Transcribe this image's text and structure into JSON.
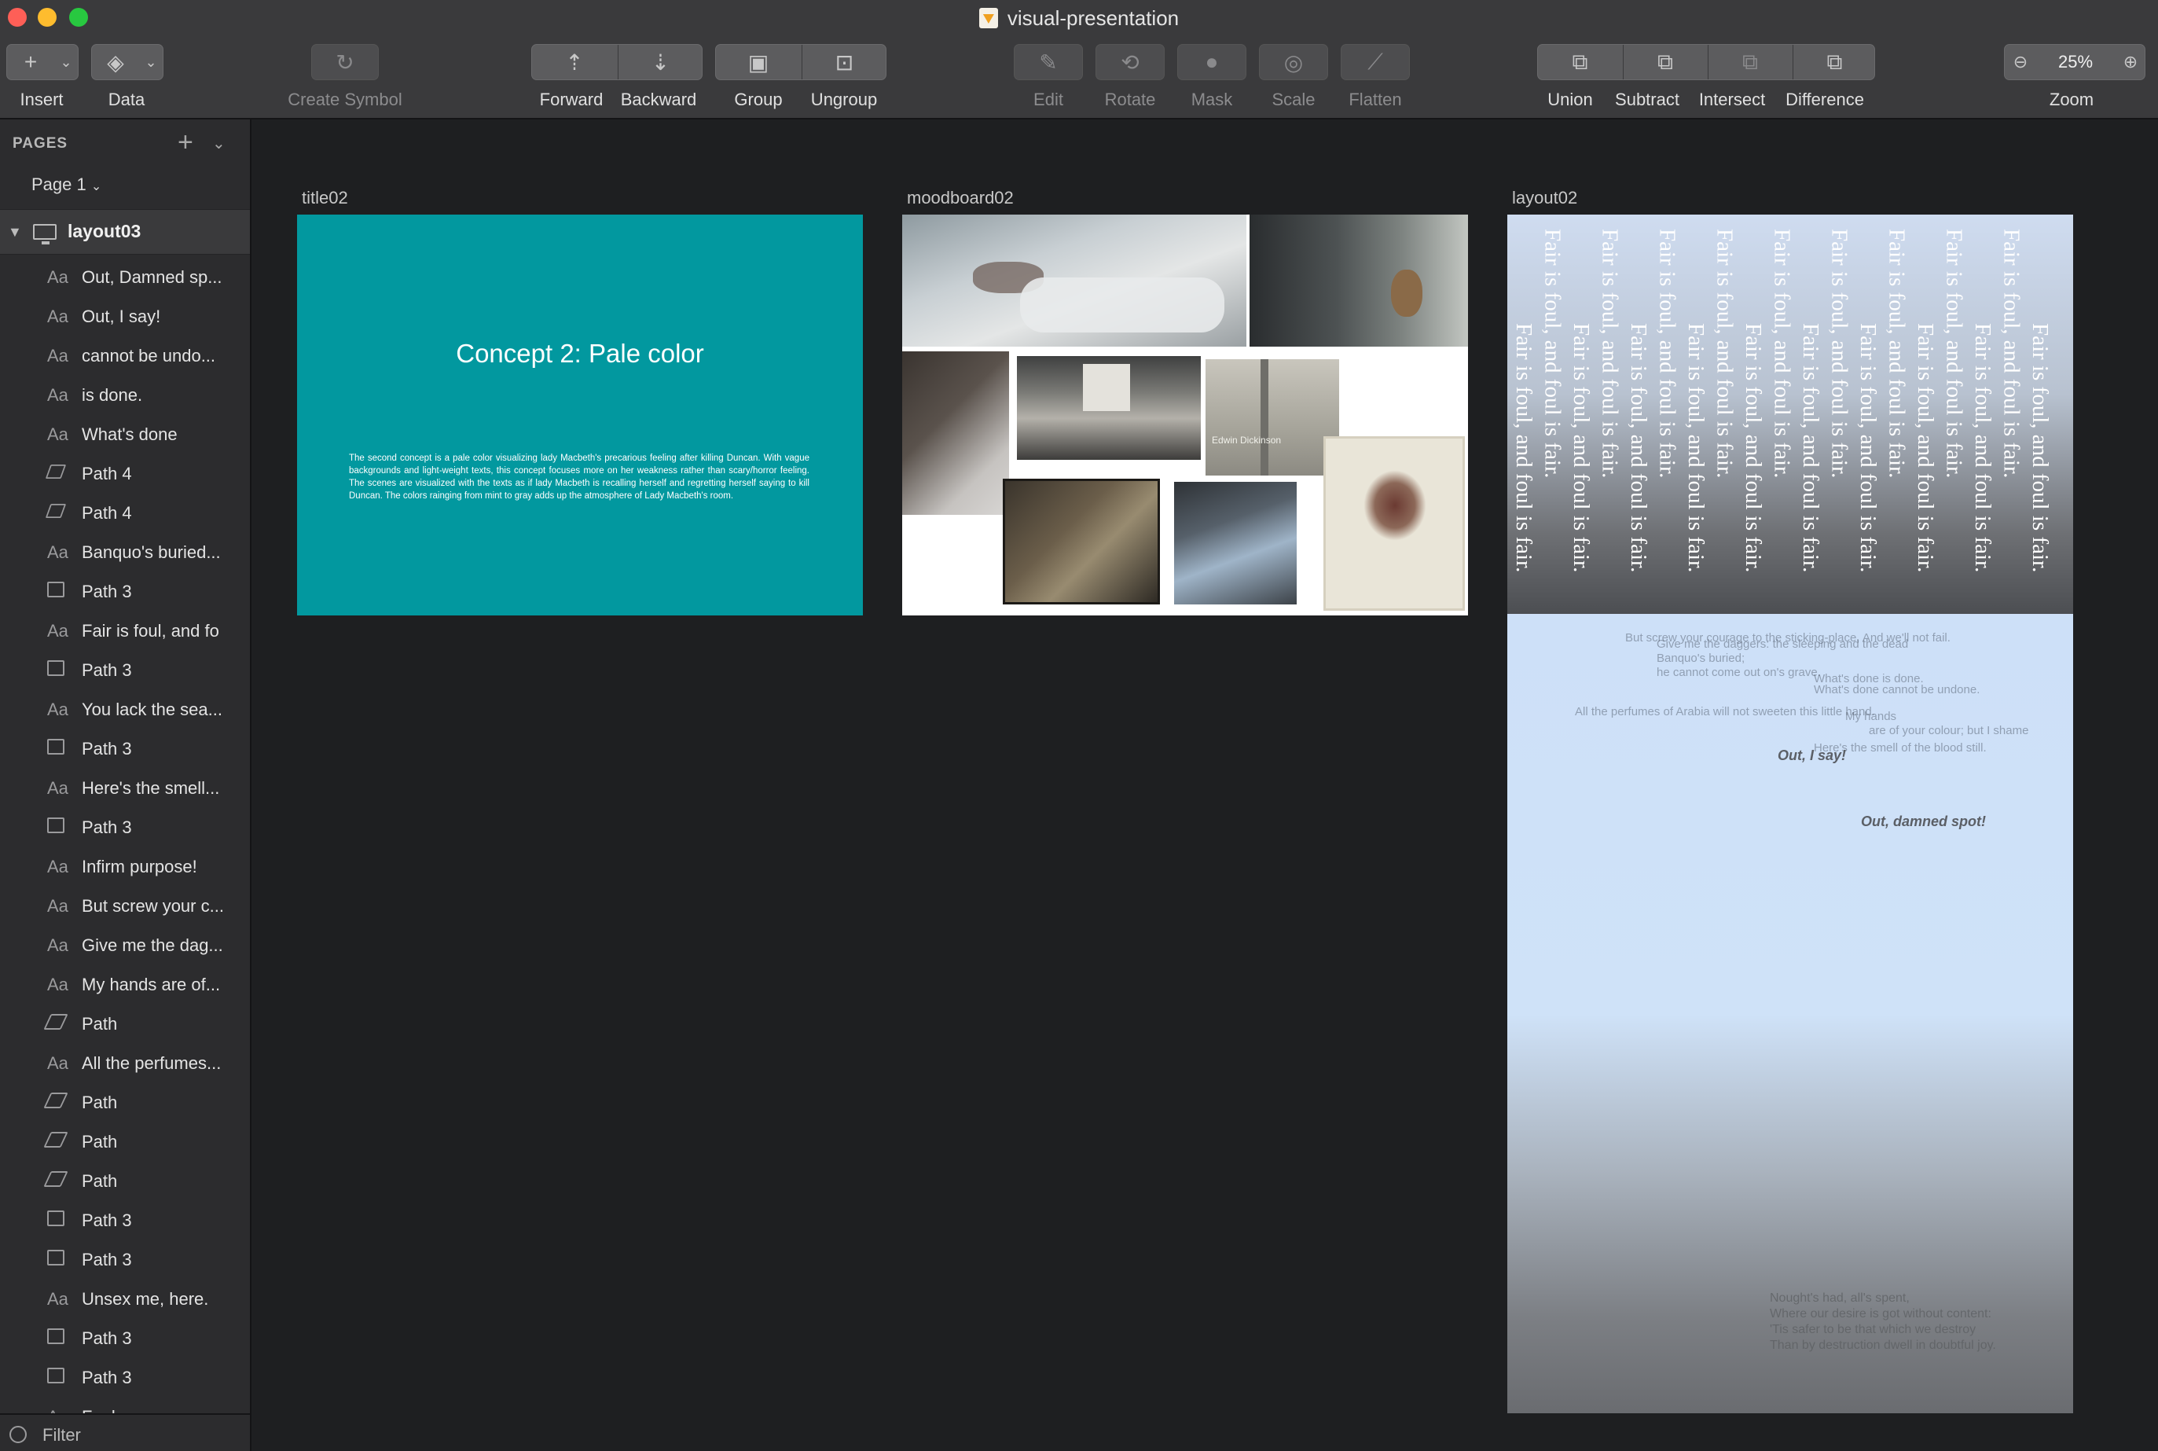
{
  "window": {
    "title": "visual-presentation"
  },
  "toolbar": {
    "insert": "Insert",
    "data": "Data",
    "create_symbol": "Create Symbol",
    "forward": "Forward",
    "backward": "Backward",
    "group": "Group",
    "ungroup": "Ungroup",
    "edit": "Edit",
    "rotate": "Rotate",
    "mask": "Mask",
    "scale": "Scale",
    "flatten": "Flatten",
    "union": "Union",
    "subtract": "Subtract",
    "intersect": "Intersect",
    "difference": "Difference",
    "zoom_value": "25%",
    "zoom": "Zoom"
  },
  "sidebar": {
    "pages_header": "PAGES",
    "page_selector": "Page 1",
    "artboard": "layout03",
    "filter": "Filter",
    "layers": [
      {
        "type": "text",
        "label": "Out, Damned sp..."
      },
      {
        "type": "text",
        "label": "Out, I say!"
      },
      {
        "type": "text",
        "label": "cannot be undo..."
      },
      {
        "type": "text",
        "label": "is done."
      },
      {
        "type": "text",
        "label": "What's done"
      },
      {
        "type": "path4",
        "label": "Path 4"
      },
      {
        "type": "path4",
        "label": "Path 4"
      },
      {
        "type": "text",
        "label": "Banquo's buried..."
      },
      {
        "type": "shape",
        "label": "Path 3"
      },
      {
        "type": "text",
        "label": "Fair is foul, and fo"
      },
      {
        "type": "shape",
        "label": "Path 3"
      },
      {
        "type": "text",
        "label": "You lack the sea..."
      },
      {
        "type": "shape",
        "label": "Path 3"
      },
      {
        "type": "text",
        "label": "Here's the smell..."
      },
      {
        "type": "shape",
        "label": "Path 3"
      },
      {
        "type": "text",
        "label": "Infirm purpose!"
      },
      {
        "type": "text",
        "label": "But screw your c..."
      },
      {
        "type": "text",
        "label": "Give me the dag..."
      },
      {
        "type": "text",
        "label": "My hands are of..."
      },
      {
        "type": "path",
        "label": "Path"
      },
      {
        "type": "text",
        "label": "All the perfumes..."
      },
      {
        "type": "path",
        "label": "Path"
      },
      {
        "type": "path",
        "label": "Path"
      },
      {
        "type": "path",
        "label": "Path"
      },
      {
        "type": "shape",
        "label": "Path 3"
      },
      {
        "type": "shape",
        "label": "Path 3"
      },
      {
        "type": "text",
        "label": "Unsex me, here."
      },
      {
        "type": "shape",
        "label": "Path 3"
      },
      {
        "type": "shape",
        "label": "Path 3"
      },
      {
        "type": "text",
        "label": "Foul"
      }
    ]
  },
  "canvas": {
    "title02": {
      "label": "title02",
      "heading": "Concept 2: Pale color",
      "body": "The second concept is a pale color visualizing lady Macbeth's precarious feeling after killing Duncan. With vague backgrounds and light-weight texts, this concept focuses more on her weakness rather than scary/horror feeling. The scenes are visualized with the texts as if lady Macbeth is recalling herself and regretting herself saying to kill Duncan. The colors rainging from mint to gray adds up the atmosphere of Lady Macbeth's room.",
      "color": "#02989f"
    },
    "moodboard02": {
      "label": "moodboard02",
      "caption": "Edwin Dickinson"
    },
    "layout02": {
      "label": "layout02",
      "vertical_text": "Fair is foul, and foul is fair.",
      "ghost_lines": [
        "But screw your courage to the sticking-place, And we'll not fail.",
        "Give me the daggers: the sleeping and the dead",
        "Banquo's buried;",
        "he cannot come out on's grave.",
        "What's done is done.",
        "What's done cannot be undone.",
        "All the perfumes of Arabia will not sweeten this little hand.",
        "My hands",
        "are of your colour; but I shame",
        "Here's the smell of the blood still."
      ],
      "quote1": "Out, I say!",
      "quote2": "Out, damned spot!",
      "bottom_lines": [
        "Nought's had, all's spent,",
        "Where our desire is got without content:",
        "'Tis safer to be that which we destroy",
        "Than by destruction dwell in doubtful joy."
      ]
    }
  }
}
